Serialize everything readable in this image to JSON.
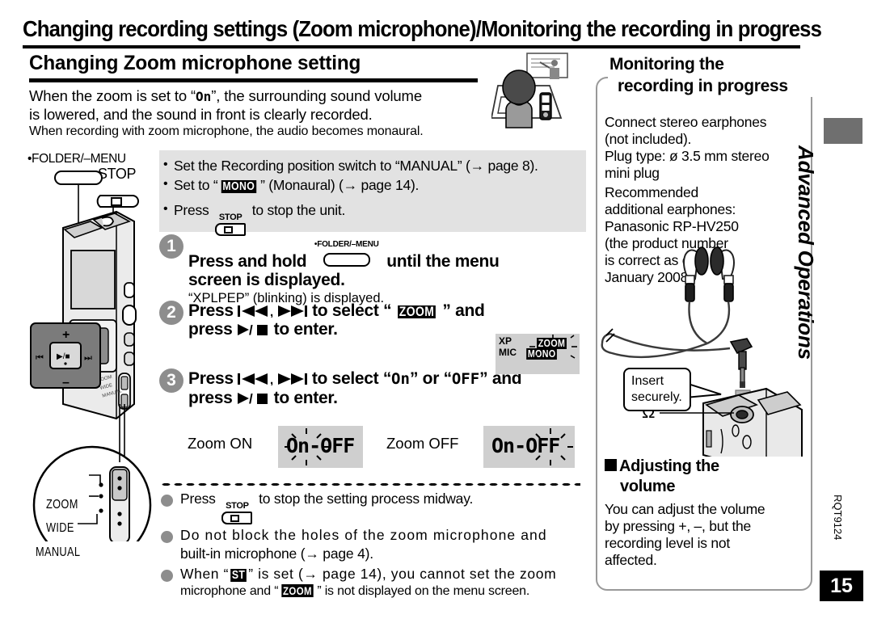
{
  "banner": {
    "title": "Changing recording settings (Zoom microphone)/Monitoring the recording in progress"
  },
  "left": {
    "heading": "Changing Zoom microphone setting",
    "intro_line1_pre": "When the zoom is set to “",
    "intro_lcd_on": "On",
    "intro_line1_post": "”, the surrounding sound volume",
    "intro_line2": "is lowered, and the sound in front is clearly recorded.",
    "intro_line3": "When recording with zoom microphone, the audio becomes monaural.",
    "preconditions": [
      "Set the Recording position switch to “MANUAL” (→ page 8).",
      "Set to “MONO” (Monaural) (→ page 14).",
      "Press STOP to stop the unit."
    ],
    "precond_1_a": "Set the Recording position switch to “MANUAL” (",
    "precond_1_b": " page 8).",
    "precond_2_a": "Set to “",
    "precond_2_chip": "MONO",
    "precond_2_b": "” (Monaural) (",
    "precond_2_c": " page 14).",
    "precond_3_a": "Press",
    "precond_3_b": "to stop the unit.",
    "steps": [
      {
        "num": "1",
        "line1_a": "Press and hold",
        "button_label": "•FOLDER/–MENU",
        "line1_b": "until the menu",
        "line2": "screen is displayed.",
        "note": "“XPLPEP” (blinking) is displayed."
      },
      {
        "num": "2",
        "line1_a": "Press",
        "line1_keys": "⏮, ⏭",
        "line1_b": "to select “",
        "chip": "ZOOM",
        "line1_c": "” and",
        "line2_a": "press",
        "line2_keys": "▶/■",
        "line2_b": "to enter."
      },
      {
        "num": "3",
        "line1_a": "Press",
        "line1_keys": "⏮, ⏭",
        "line1_b": "to select “",
        "opt_on": "On",
        "line1_mid": "” or “",
        "opt_off": "OFF",
        "line1_c": "” and",
        "line2_a": "press",
        "line2_keys": "▶/■",
        "line2_b": "to enter."
      }
    ],
    "lcd_menu": {
      "xp": "XP",
      "mic": "MIC",
      "mono": "MONO",
      "zoom": "ZOOM"
    },
    "zoom_on_label": "Zoom ON",
    "zoom_off_label": "Zoom OFF",
    "lcd_on_text": "On-OFF",
    "lcd_off_text": "On-OFF",
    "notes": [
      {
        "a": "Press",
        "b": "to stop the setting process midway."
      },
      {
        "a": "Do not block the holes of the zoom microphone and",
        "b": "built-in microphone (→ page 4)."
      },
      {
        "a_pre": "When “",
        "chip": "ST",
        "a_post": "” is set (→ page 14), you cannot set the zoom",
        "b_pre": "microphone and “",
        "chip2": "ZOOM",
        "b_post": "” is not displayed on the menu screen."
      }
    ],
    "device_labels": {
      "folder_menu": "•FOLDER/–MENU",
      "stop": "STOP",
      "zoom": "ZOOM",
      "wide": "WIDE",
      "manual": "MANUAL",
      "plus": "+",
      "minus": "–",
      "prev": "⏮",
      "next": "⏭",
      "playstop": "▶/■"
    }
  },
  "right": {
    "title_line1": "Monitoring the",
    "title_line2": "recording in progress",
    "body1": "Connect stereo earphones (not included).\nPlug type: ø 3.5 mm stereo mini plug",
    "body1_l1": "Connect stereo earphones",
    "body1_l2": "(not included).",
    "body1_l3": "Plug type: ø 3.5 mm stereo",
    "body1_l4": "mini plug",
    "body2_l1": "Recommended",
    "body2_l2": "additional earphones:",
    "body2_l3": "Panasonic RP-HV250",
    "body2_l4": "(the product number",
    "body2_l5": "is correct as of",
    "body2_l6": "January 2008.)",
    "callout_l1": "Insert",
    "callout_l2": "securely.",
    "headphone_symbol": "Ω",
    "subhead_l1": "Adjusting the",
    "subhead_l2": "volume",
    "body3_l1": "You can adjust the volume",
    "body3_l2": "by pressing +, –, but the",
    "body3_l3": "recording level is not",
    "body3_l4": "affected."
  },
  "sidebar": {
    "section": "Advanced Operations",
    "doc_code": "RQT9124",
    "page_number": "15"
  },
  "colors": {
    "gray_box": "#e2e2e2",
    "lcd_bg": "#cfcfcf",
    "step_circle": "#8d8d8d",
    "tab_gray": "#6f6f6f",
    "border_gray": "#999999"
  }
}
